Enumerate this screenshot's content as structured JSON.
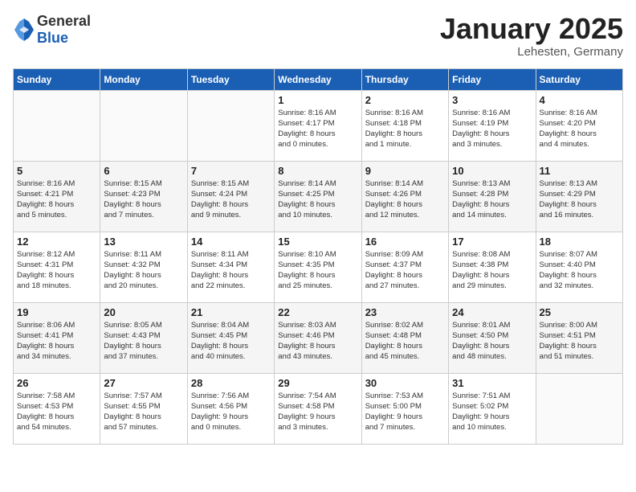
{
  "header": {
    "logo_general": "General",
    "logo_blue": "Blue",
    "month": "January 2025",
    "location": "Lehesten, Germany"
  },
  "weekdays": [
    "Sunday",
    "Monday",
    "Tuesday",
    "Wednesday",
    "Thursday",
    "Friday",
    "Saturday"
  ],
  "weeks": [
    [
      {
        "day": "",
        "info": ""
      },
      {
        "day": "",
        "info": ""
      },
      {
        "day": "",
        "info": ""
      },
      {
        "day": "1",
        "info": "Sunrise: 8:16 AM\nSunset: 4:17 PM\nDaylight: 8 hours\nand 0 minutes."
      },
      {
        "day": "2",
        "info": "Sunrise: 8:16 AM\nSunset: 4:18 PM\nDaylight: 8 hours\nand 1 minute."
      },
      {
        "day": "3",
        "info": "Sunrise: 8:16 AM\nSunset: 4:19 PM\nDaylight: 8 hours\nand 3 minutes."
      },
      {
        "day": "4",
        "info": "Sunrise: 8:16 AM\nSunset: 4:20 PM\nDaylight: 8 hours\nand 4 minutes."
      }
    ],
    [
      {
        "day": "5",
        "info": "Sunrise: 8:16 AM\nSunset: 4:21 PM\nDaylight: 8 hours\nand 5 minutes."
      },
      {
        "day": "6",
        "info": "Sunrise: 8:15 AM\nSunset: 4:23 PM\nDaylight: 8 hours\nand 7 minutes."
      },
      {
        "day": "7",
        "info": "Sunrise: 8:15 AM\nSunset: 4:24 PM\nDaylight: 8 hours\nand 9 minutes."
      },
      {
        "day": "8",
        "info": "Sunrise: 8:14 AM\nSunset: 4:25 PM\nDaylight: 8 hours\nand 10 minutes."
      },
      {
        "day": "9",
        "info": "Sunrise: 8:14 AM\nSunset: 4:26 PM\nDaylight: 8 hours\nand 12 minutes."
      },
      {
        "day": "10",
        "info": "Sunrise: 8:13 AM\nSunset: 4:28 PM\nDaylight: 8 hours\nand 14 minutes."
      },
      {
        "day": "11",
        "info": "Sunrise: 8:13 AM\nSunset: 4:29 PM\nDaylight: 8 hours\nand 16 minutes."
      }
    ],
    [
      {
        "day": "12",
        "info": "Sunrise: 8:12 AM\nSunset: 4:31 PM\nDaylight: 8 hours\nand 18 minutes."
      },
      {
        "day": "13",
        "info": "Sunrise: 8:11 AM\nSunset: 4:32 PM\nDaylight: 8 hours\nand 20 minutes."
      },
      {
        "day": "14",
        "info": "Sunrise: 8:11 AM\nSunset: 4:34 PM\nDaylight: 8 hours\nand 22 minutes."
      },
      {
        "day": "15",
        "info": "Sunrise: 8:10 AM\nSunset: 4:35 PM\nDaylight: 8 hours\nand 25 minutes."
      },
      {
        "day": "16",
        "info": "Sunrise: 8:09 AM\nSunset: 4:37 PM\nDaylight: 8 hours\nand 27 minutes."
      },
      {
        "day": "17",
        "info": "Sunrise: 8:08 AM\nSunset: 4:38 PM\nDaylight: 8 hours\nand 29 minutes."
      },
      {
        "day": "18",
        "info": "Sunrise: 8:07 AM\nSunset: 4:40 PM\nDaylight: 8 hours\nand 32 minutes."
      }
    ],
    [
      {
        "day": "19",
        "info": "Sunrise: 8:06 AM\nSunset: 4:41 PM\nDaylight: 8 hours\nand 34 minutes."
      },
      {
        "day": "20",
        "info": "Sunrise: 8:05 AM\nSunset: 4:43 PM\nDaylight: 8 hours\nand 37 minutes."
      },
      {
        "day": "21",
        "info": "Sunrise: 8:04 AM\nSunset: 4:45 PM\nDaylight: 8 hours\nand 40 minutes."
      },
      {
        "day": "22",
        "info": "Sunrise: 8:03 AM\nSunset: 4:46 PM\nDaylight: 8 hours\nand 43 minutes."
      },
      {
        "day": "23",
        "info": "Sunrise: 8:02 AM\nSunset: 4:48 PM\nDaylight: 8 hours\nand 45 minutes."
      },
      {
        "day": "24",
        "info": "Sunrise: 8:01 AM\nSunset: 4:50 PM\nDaylight: 8 hours\nand 48 minutes."
      },
      {
        "day": "25",
        "info": "Sunrise: 8:00 AM\nSunset: 4:51 PM\nDaylight: 8 hours\nand 51 minutes."
      }
    ],
    [
      {
        "day": "26",
        "info": "Sunrise: 7:58 AM\nSunset: 4:53 PM\nDaylight: 8 hours\nand 54 minutes."
      },
      {
        "day": "27",
        "info": "Sunrise: 7:57 AM\nSunset: 4:55 PM\nDaylight: 8 hours\nand 57 minutes."
      },
      {
        "day": "28",
        "info": "Sunrise: 7:56 AM\nSunset: 4:56 PM\nDaylight: 9 hours\nand 0 minutes."
      },
      {
        "day": "29",
        "info": "Sunrise: 7:54 AM\nSunset: 4:58 PM\nDaylight: 9 hours\nand 3 minutes."
      },
      {
        "day": "30",
        "info": "Sunrise: 7:53 AM\nSunset: 5:00 PM\nDaylight: 9 hours\nand 7 minutes."
      },
      {
        "day": "31",
        "info": "Sunrise: 7:51 AM\nSunset: 5:02 PM\nDaylight: 9 hours\nand 10 minutes."
      },
      {
        "day": "",
        "info": ""
      }
    ]
  ]
}
